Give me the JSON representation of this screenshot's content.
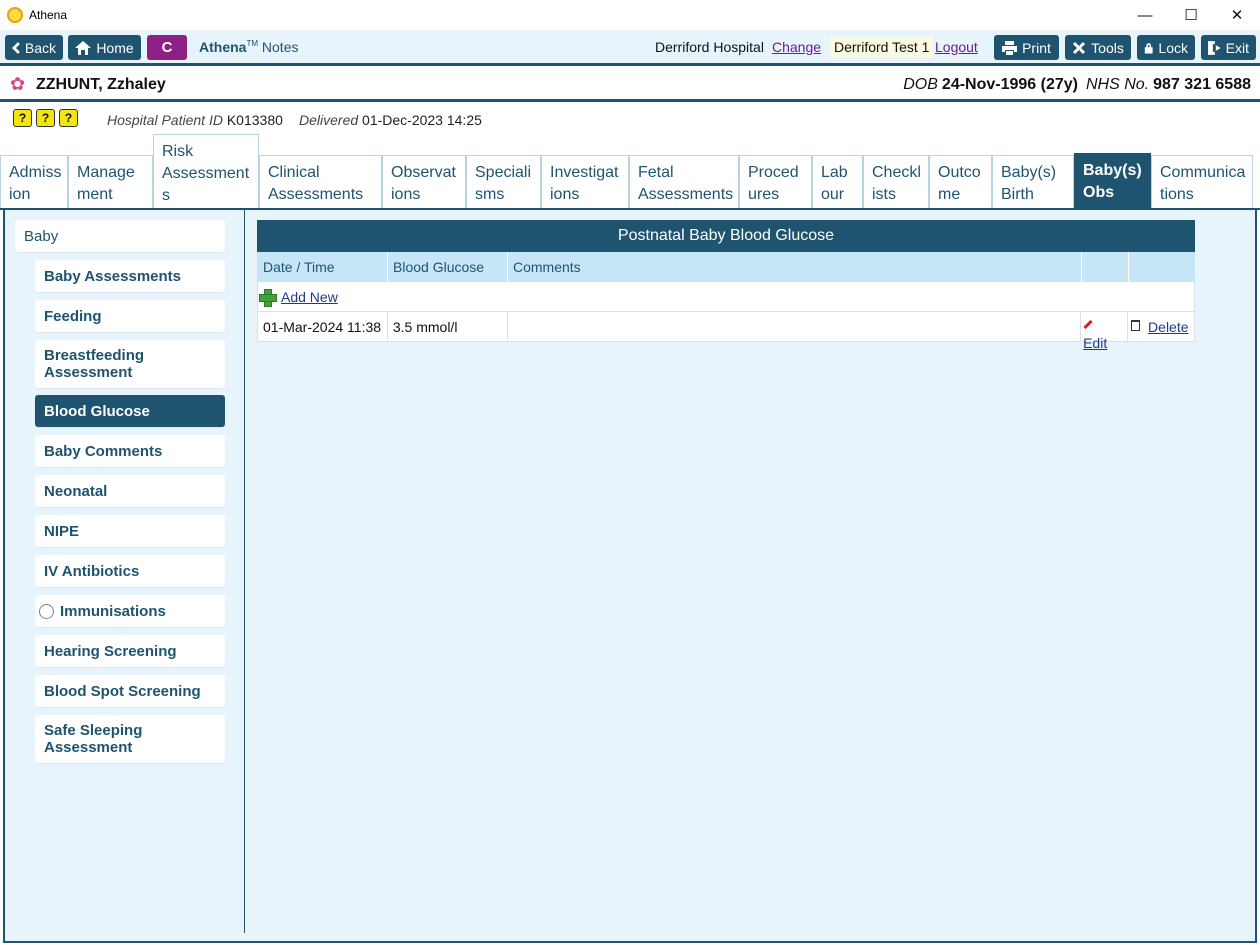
{
  "window": {
    "title": "Athena",
    "minimize": "—",
    "maximize": "☐",
    "close": "✕"
  },
  "toolbar": {
    "back": "Back",
    "home": "Home",
    "c_button": "C",
    "brand_name": "Athena",
    "brand_tm": "TM",
    "brand_suffix": "Notes",
    "hospital": "Derriford Hospital",
    "change": "Change",
    "user": "Derriford Test 1",
    "logout": "Logout",
    "print": "Print",
    "tools": "Tools",
    "lock": "Lock",
    "exit": "Exit"
  },
  "patient": {
    "name": "ZZHUNT, Zzhaley",
    "dob_label": "DOB",
    "dob": "24-Nov-1996 (27y)",
    "nhs_label": "NHS No.",
    "nhs": "987 321 6588"
  },
  "info": {
    "alerts": [
      "?",
      "?",
      "?"
    ],
    "hospital_id_label": "Hospital Patient ID",
    "hospital_id": "K013380",
    "delivered_label": "Delivered",
    "delivered": "01-Dec-2023 14:25"
  },
  "tabs": [
    {
      "line1": "Admiss",
      "line2": "ion"
    },
    {
      "line1": "Manage",
      "line2": "ment"
    },
    {
      "line1": "Risk",
      "line2": "Assessment",
      "line3": "s"
    },
    {
      "line1": "Clinical",
      "line2": "Assessments"
    },
    {
      "line1": "Observat",
      "line2": "ions"
    },
    {
      "line1": "Speciali",
      "line2": "sms"
    },
    {
      "line1": "Investigat",
      "line2": "ions"
    },
    {
      "line1": "Fetal",
      "line2": "Assessments"
    },
    {
      "line1": "Proced",
      "line2": "ures"
    },
    {
      "line1": "Lab",
      "line2": "our"
    },
    {
      "line1": "Checkl",
      "line2": "ists"
    },
    {
      "line1": "Outco",
      "line2": "me"
    },
    {
      "line1": "Baby(s)",
      "line2": "Birth"
    },
    {
      "line1": "Baby(s)",
      "line2": "Obs"
    },
    {
      "line1": "Communica",
      "line2": "tions"
    }
  ],
  "sidebar": {
    "group": "Baby",
    "items": [
      {
        "label": "Baby Assessments"
      },
      {
        "label": "Feeding"
      },
      {
        "label": "Breastfeeding",
        "label2": "Assessment"
      },
      {
        "label": "Blood Glucose"
      },
      {
        "label": "Baby Comments"
      },
      {
        "label": "Neonatal"
      },
      {
        "label": "NIPE"
      },
      {
        "label": "IV Antibiotics"
      },
      {
        "label": "Immunisations"
      },
      {
        "label": "Hearing Screening"
      },
      {
        "label": "Blood Spot Screening"
      },
      {
        "label": "Safe Sleeping",
        "label2": "Assessment"
      }
    ]
  },
  "grid": {
    "title": "Postnatal Baby Blood Glucose",
    "headers": [
      "Date / Time",
      "Blood Glucose",
      "Comments",
      "",
      ""
    ],
    "add_new": "Add New",
    "rows": [
      {
        "datetime": "01-Mar-2024 11:38",
        "glucose": "3.5 mmol/l",
        "comments": "",
        "edit": "Edit",
        "delete": "Delete"
      }
    ]
  }
}
